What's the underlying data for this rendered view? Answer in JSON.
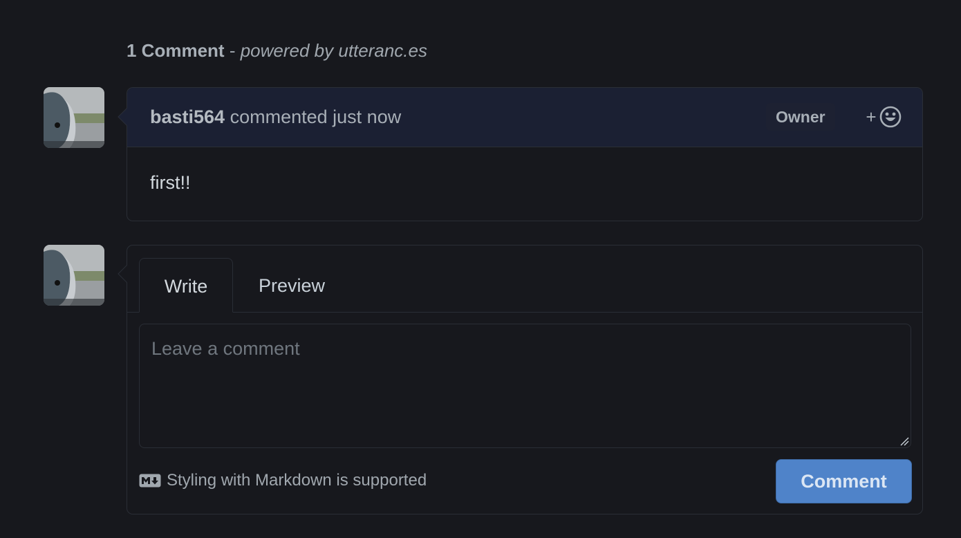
{
  "header": {
    "count_label": "1 Comment",
    "separator": "-",
    "powered_by": "powered by utteranc.es"
  },
  "comments": [
    {
      "author": "basti564",
      "meta": "commented just now",
      "badge": "Owner",
      "reaction_plus": "+",
      "body": "first!!"
    }
  ],
  "form": {
    "tabs": [
      "Write",
      "Preview"
    ],
    "active_tab": "Write",
    "textarea_placeholder": "Leave a comment",
    "textarea_value": "",
    "markdown_note": "Styling with Markdown is supported",
    "submit_label": "Comment"
  },
  "icons": {
    "reaction": "smiley-icon",
    "markdown": "markdown-icon",
    "avatar": "user-avatar"
  },
  "colors": {
    "background": "#17181d",
    "header_bg": "#1b2033",
    "border": "#2a2e36",
    "button": "#4f83c9"
  }
}
